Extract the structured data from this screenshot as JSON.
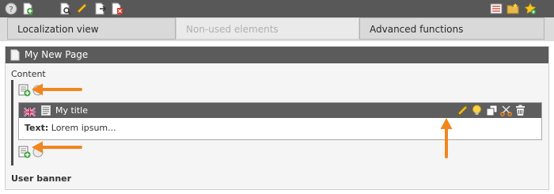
{
  "toolbar": {
    "icons": [
      "help-icon",
      "new-page-icon",
      "preview-icon",
      "edit-pencil-icon",
      "move-icon",
      "delete-icon",
      "list-icon",
      "folder-star-icon",
      "favorite-star-icon"
    ]
  },
  "tabs": [
    {
      "label": "Localization view",
      "state": "active"
    },
    {
      "label": "Non-used elements",
      "state": "disabled"
    },
    {
      "label": "Advanced functions",
      "state": "active"
    }
  ],
  "page": {
    "title": "My New Page",
    "column_label": "Content",
    "element": {
      "language": "English",
      "title": "My title",
      "body_label": "Text:",
      "body_text": "Lorem ipsum..."
    },
    "next_column_label": "User banner"
  },
  "colors": {
    "toolbar": "#585858",
    "panel_header": "#5b5b5b",
    "arrow": "#f0861e"
  }
}
